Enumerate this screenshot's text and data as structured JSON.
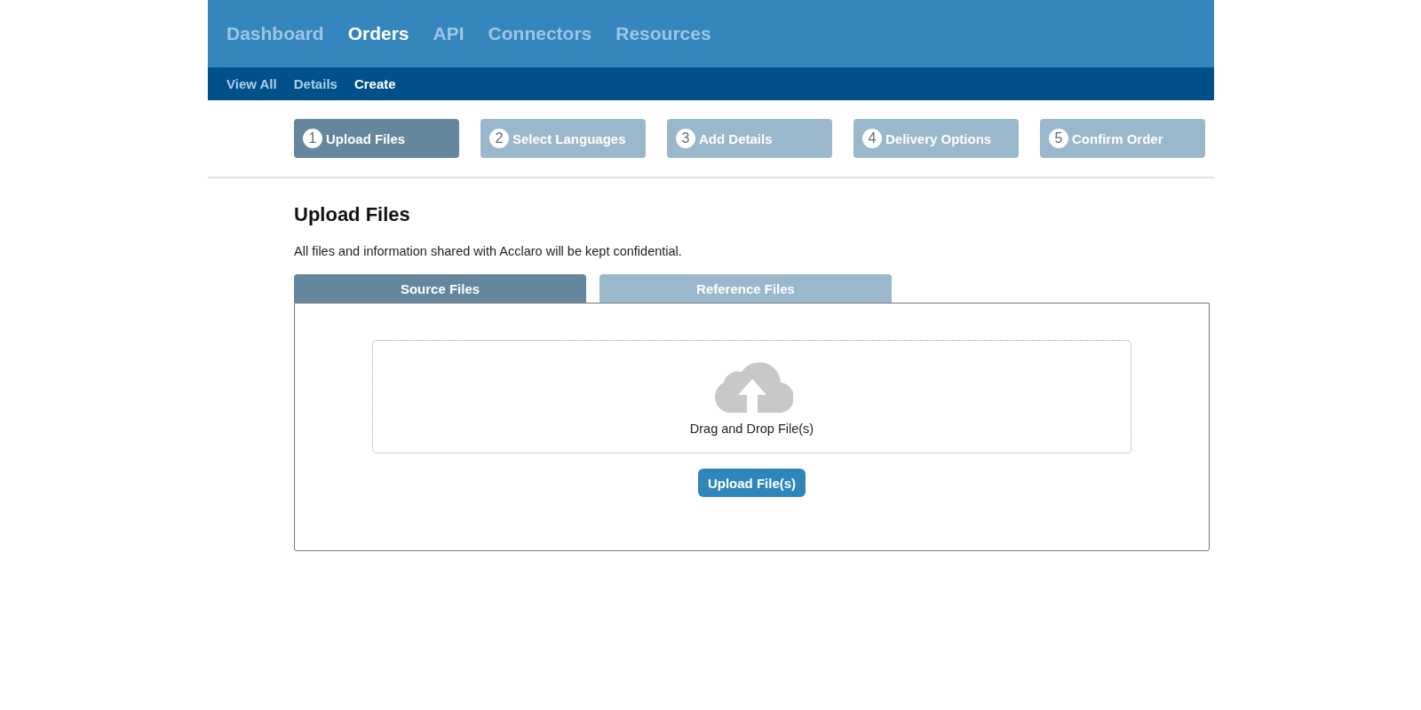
{
  "main_nav": [
    {
      "label": "Dashboard",
      "selected": false
    },
    {
      "label": "Orders",
      "selected": true
    },
    {
      "label": "API",
      "selected": false
    },
    {
      "label": "Connectors",
      "selected": false
    },
    {
      "label": "Resources",
      "selected": false
    }
  ],
  "sub_nav": [
    {
      "label": "View All",
      "selected": false
    },
    {
      "label": "Details",
      "selected": false
    },
    {
      "label": "Create",
      "selected": true
    }
  ],
  "steps": [
    {
      "number": "1",
      "label": "Upload Files",
      "selected": true
    },
    {
      "number": "2",
      "label": "Select Languages",
      "selected": false
    },
    {
      "number": "3",
      "label": "Add Details",
      "selected": false
    },
    {
      "number": "4",
      "label": "Delivery Options",
      "selected": false
    },
    {
      "number": "5",
      "label": "Confirm Order",
      "selected": false
    }
  ],
  "page": {
    "title": "Upload Files",
    "notice": "All files and information shared with Acclaro will be kept confidential."
  },
  "file_tabs": [
    {
      "label": "Source Files",
      "selected": true
    },
    {
      "label": "Reference Files",
      "selected": false
    }
  ],
  "dropzone": {
    "label": "Drag and Drop File(s)"
  },
  "upload_button": "Upload File(s)"
}
